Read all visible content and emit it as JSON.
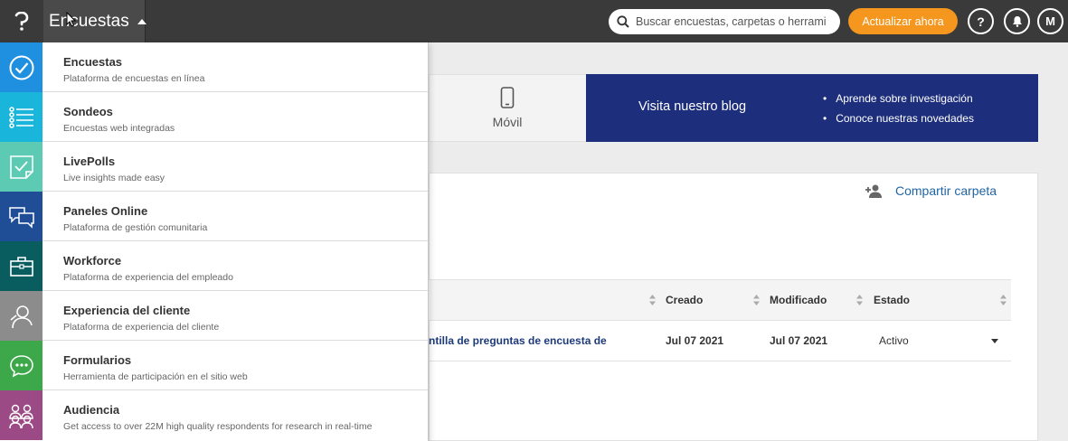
{
  "header": {
    "app_name": "Encuestas",
    "search_placeholder": "Buscar encuestas, carpetas o herrami",
    "upgrade_label": "Actualizar ahora",
    "help_label": "?",
    "avatar_initial": "M"
  },
  "menu": {
    "items": [
      {
        "title": "Encuestas",
        "subtitle": "Plataforma de encuestas en línea",
        "color": "#1f8fe0",
        "icon": "check-circle-icon"
      },
      {
        "title": "Sondeos",
        "subtitle": "Encuestas web integradas",
        "color": "#1ab5db",
        "icon": "list-icon"
      },
      {
        "title": "LivePolls",
        "subtitle": "Live insights made easy",
        "color": "#5dcab3",
        "icon": "note-check-icon"
      },
      {
        "title": "Paneles Online",
        "subtitle": "Plataforma de gestión comunitaria",
        "color": "#1f4d96",
        "icon": "chat-bubbles-icon"
      },
      {
        "title": "Workforce",
        "subtitle": "Plataforma de experiencia del empleado",
        "color": "#0a5d5f",
        "icon": "briefcase-icon"
      },
      {
        "title": "Experiencia del cliente",
        "subtitle": "Plataforma de experiencia del cliente",
        "color": "#8c8c8c",
        "icon": "person-support-icon"
      },
      {
        "title": "Formularios",
        "subtitle": "Herramienta de participación en el sitio web",
        "color": "#3ca84a",
        "icon": "speech-bubble-icon"
      },
      {
        "title": "Audiencia",
        "subtitle": "Get access to over 22M high quality respondents for research in real-time",
        "color": "#9b4a86",
        "icon": "people-group-icon"
      }
    ]
  },
  "banner": {
    "mobile_label": "Móvil",
    "blog_title": "Visita nuestro blog",
    "blog_points": [
      "Aprende sobre investigación",
      "Conoce nuestras novedades"
    ]
  },
  "folder": {
    "share_label": "Compartir carpeta"
  },
  "table": {
    "headers": {
      "created": "Creado",
      "modified": "Modificado",
      "status": "Estado"
    },
    "rows": [
      {
        "name": "ntilla de preguntas de encuesta de",
        "created": "Jul 07 2021",
        "modified": "Jul 07 2021",
        "status": "Activo"
      }
    ]
  }
}
